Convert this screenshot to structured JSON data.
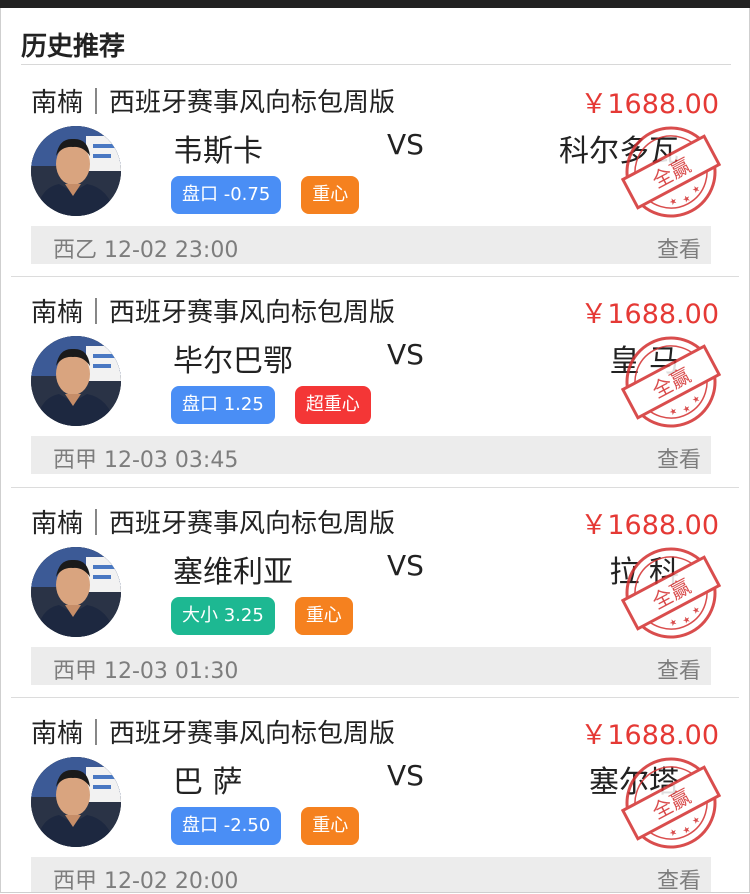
{
  "section": {
    "title": "历史推荐"
  },
  "colors": {
    "price": "#e53935",
    "blue_tag": "#4a8ef5",
    "orange_tag": "#f5811f",
    "red_tag": "#f43636",
    "green_tag": "#1db892",
    "stamp": "#d32f2f"
  },
  "cards": [
    {
      "plan_title": "南楠｜西班牙赛事风向标包周版",
      "price": "￥1688.00",
      "home": "韦斯卡",
      "vs": "VS",
      "away": "科尔多瓦",
      "tag1": "盘口 -0.75",
      "tag1_color": "blue",
      "tag2": "重心",
      "tag2_color": "orange",
      "date": "西乙 12-02 23:00",
      "view": "查看",
      "stamp": "全赢",
      "stamp_icon": "win-stamp-icon"
    },
    {
      "plan_title": "南楠｜西班牙赛事风向标包周版",
      "price": "￥1688.00",
      "home": "毕尔巴鄂",
      "vs": "VS",
      "away": "皇 马",
      "tag1": "盘口 1.25",
      "tag1_color": "blue",
      "tag2": "超重心",
      "tag2_color": "red",
      "date": "西甲 12-03 03:45",
      "view": "查看",
      "stamp": "全赢",
      "stamp_icon": "win-stamp-icon"
    },
    {
      "plan_title": "南楠｜西班牙赛事风向标包周版",
      "price": "￥1688.00",
      "home": "塞维利亚",
      "vs": "VS",
      "away": "拉 科",
      "tag1": "大小 3.25",
      "tag1_color": "green",
      "tag2": "重心",
      "tag2_color": "orange",
      "date": "西甲 12-03 01:30",
      "view": "查看",
      "stamp": "全赢",
      "stamp_icon": "win-stamp-icon"
    },
    {
      "plan_title": "南楠｜西班牙赛事风向标包周版",
      "price": "￥1688.00",
      "home": "巴 萨",
      "vs": "VS",
      "away": "塞尔塔",
      "tag1": "盘口 -2.50",
      "tag1_color": "blue",
      "tag2": "重心",
      "tag2_color": "orange",
      "date": "西甲 12-02 20:00",
      "view": "查看",
      "stamp": "全赢",
      "stamp_icon": "win-stamp-icon"
    }
  ]
}
